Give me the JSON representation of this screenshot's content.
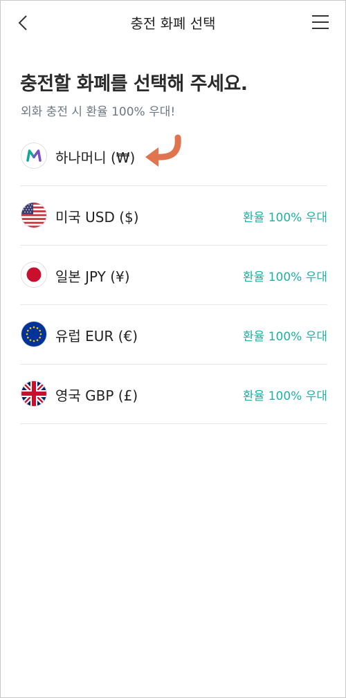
{
  "header": {
    "title": "충전 화폐 선택",
    "back_icon": "chevron-left-icon",
    "menu_icon": "hamburger-menu-icon"
  },
  "main": {
    "headline": "충전할 화폐를 선택해 주세요.",
    "subline": "외화 충전 시 환율 100% 우대!"
  },
  "currencies": [
    {
      "label": "하나머니 (₩)",
      "icon": "hana-money-logo-icon",
      "rate_text": ""
    },
    {
      "label": "미국 USD ($)",
      "icon": "us-flag-icon",
      "rate_text": "환율 100% 우대"
    },
    {
      "label": "일본 JPY (¥)",
      "icon": "japan-flag-icon",
      "rate_text": "환율 100% 우대"
    },
    {
      "label": "유럽 EUR (€)",
      "icon": "eu-flag-icon",
      "rate_text": "환율 100% 우대"
    },
    {
      "label": "영국 GBP (£)",
      "icon": "uk-flag-icon",
      "rate_text": "환율 100% 우대"
    }
  ],
  "colors": {
    "accent_teal": "#1fb0a4",
    "annotation_arrow": "#e0744e",
    "hana_logo_teal": "#14a79a",
    "hana_logo_purple": "#7c4fc4"
  }
}
